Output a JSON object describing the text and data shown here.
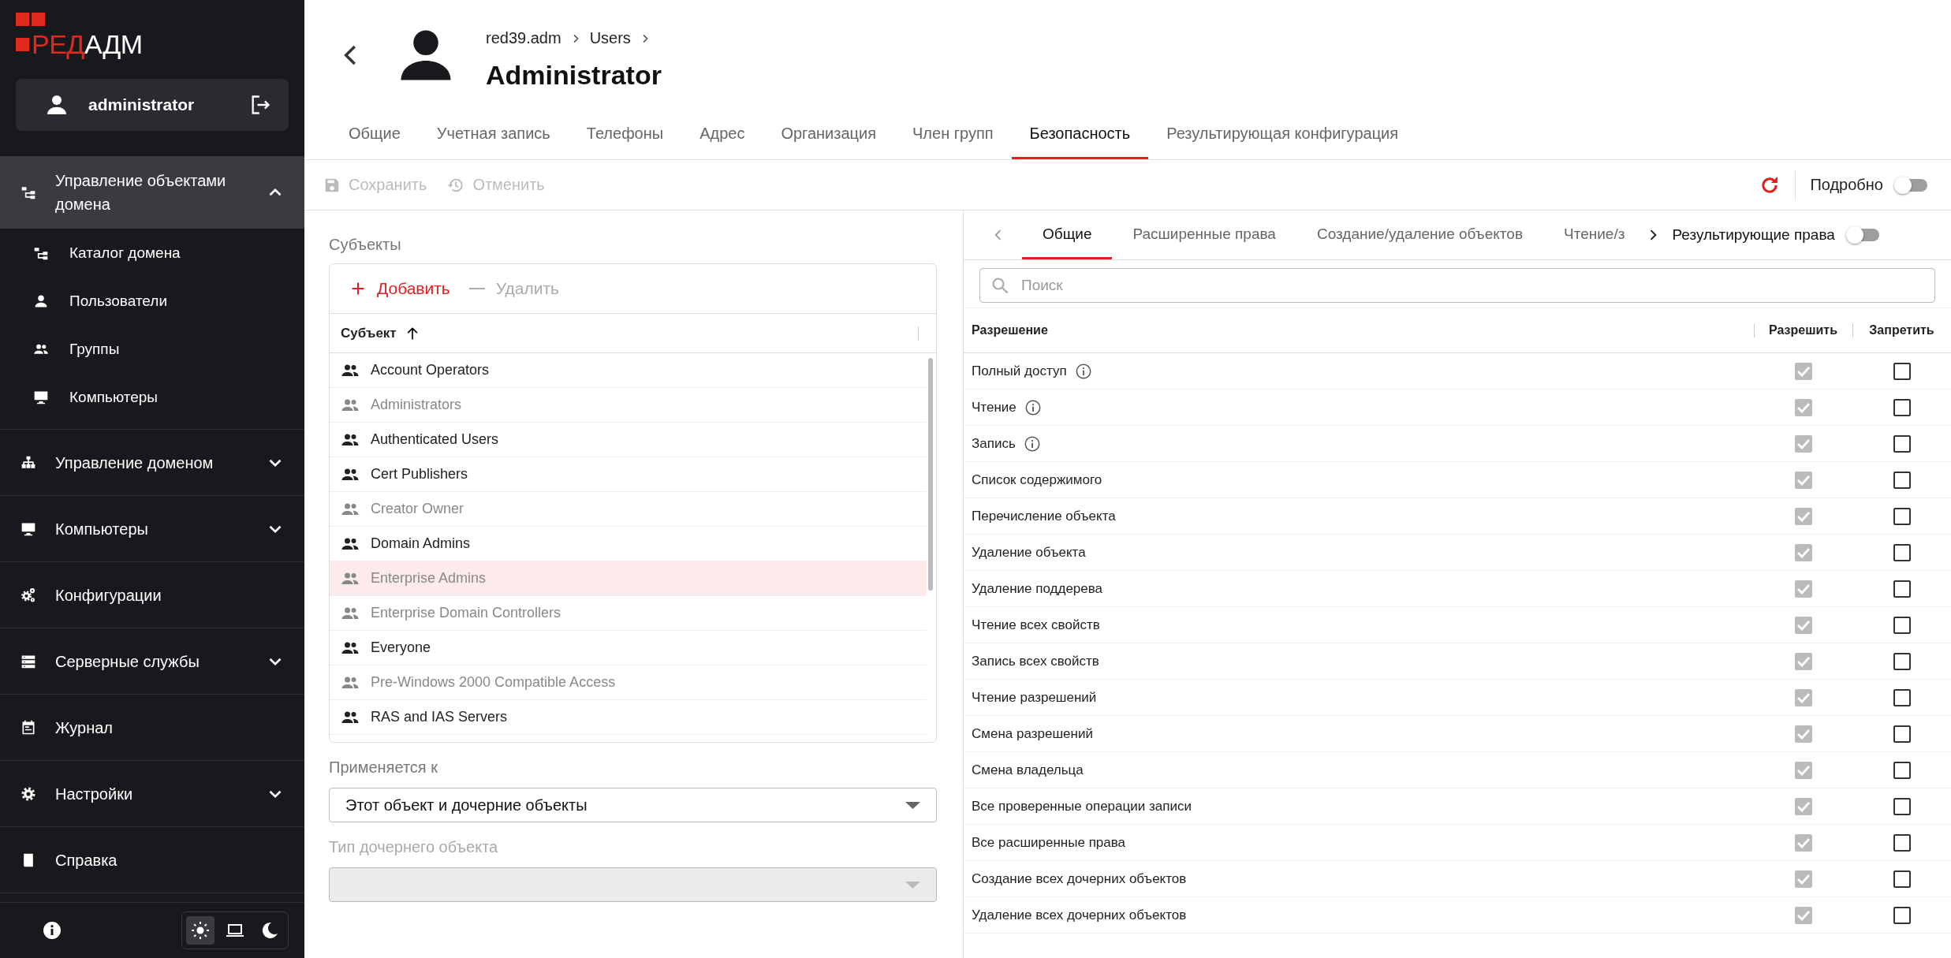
{
  "sidebar": {
    "logo": {
      "text_1": "РЕД",
      "text_2": "АДМ"
    },
    "user": {
      "name": "administrator"
    },
    "nav": [
      {
        "label": "Управление объектами домена",
        "selected": true,
        "expanded": true,
        "children": [
          {
            "label": "Каталог домена",
            "selected": false
          },
          {
            "label": "Пользователи",
            "selected": false
          },
          {
            "label": "Группы",
            "selected": false
          },
          {
            "label": "Компьютеры",
            "selected": false
          }
        ]
      },
      {
        "label": "Управление доменом",
        "selected": false,
        "expanded": false
      },
      {
        "label": "Компьютеры",
        "selected": false,
        "expanded": false
      },
      {
        "label": "Конфигурации",
        "selected": false
      },
      {
        "label": "Серверные службы",
        "selected": false,
        "expanded": false
      },
      {
        "label": "Журнал",
        "selected": false
      },
      {
        "label": "Настройки",
        "selected": false,
        "expanded": false
      },
      {
        "label": "Справка",
        "selected": false
      }
    ],
    "theme_modes": [
      {
        "selected": true
      },
      {
        "selected": false
      },
      {
        "selected": false
      }
    ]
  },
  "header": {
    "breadcrumb": [
      "red39.adm",
      "Users"
    ],
    "title": "Administrator"
  },
  "tabs": [
    {
      "label": "Общие",
      "selected": false
    },
    {
      "label": "Учетная запись",
      "selected": false
    },
    {
      "label": "Телефоны",
      "selected": false
    },
    {
      "label": "Адрес",
      "selected": false
    },
    {
      "label": "Организация",
      "selected": false
    },
    {
      "label": "Член групп",
      "selected": false
    },
    {
      "label": "Безопасность",
      "selected": true
    },
    {
      "label": "Результирующая конфигурация",
      "selected": false
    }
  ],
  "toolbar": {
    "buttons": [
      {
        "label": "Сохранить",
        "disabled": true
      },
      {
        "label": "Отменить",
        "disabled": true
      }
    ],
    "details_toggle": {
      "label": "Подробно",
      "on": false
    }
  },
  "subjects": {
    "title": "Субъекты",
    "actions": [
      {
        "label": "Добавить",
        "disabled": false
      },
      {
        "label": "Удалить",
        "disabled": true
      }
    ],
    "column": "Субъект",
    "rows": [
      {
        "name": "Account Operators",
        "inherited": false,
        "selected": false
      },
      {
        "name": "Administrators",
        "inherited": true,
        "selected": false
      },
      {
        "name": "Authenticated Users",
        "inherited": false,
        "selected": false
      },
      {
        "name": "Cert Publishers",
        "inherited": false,
        "selected": false
      },
      {
        "name": "Creator Owner",
        "inherited": true,
        "selected": false
      },
      {
        "name": "Domain Admins",
        "inherited": false,
        "selected": false
      },
      {
        "name": "Enterprise Admins",
        "inherited": true,
        "selected": true
      },
      {
        "name": "Enterprise Domain Controllers",
        "inherited": true,
        "selected": false
      },
      {
        "name": "Everyone",
        "inherited": false,
        "selected": false
      },
      {
        "name": "Pre-Windows 2000 Compatible Access",
        "inherited": true,
        "selected": false
      },
      {
        "name": "RAS and IAS Servers",
        "inherited": false,
        "selected": false
      }
    ]
  },
  "applies_to": {
    "label": "Применяется к",
    "value": "Этот объект и дочерние объекты"
  },
  "child_type": {
    "label": "Тип дочернего объекта",
    "disabled": true
  },
  "rights": {
    "tabs": [
      {
        "label": "Общие",
        "selected": true
      },
      {
        "label": "Расширенные права",
        "selected": false
      },
      {
        "label": "Создание/удаление объектов",
        "selected": false
      },
      {
        "label": "Чтение/з",
        "selected": false
      }
    ],
    "result_toggle": {
      "label": "Результирующие права",
      "on": false
    },
    "search": {
      "placeholder": "Поиск"
    },
    "columns": [
      "Разрешение",
      "Разрешить",
      "Запретить"
    ],
    "rows": [
      {
        "name": "Полный доступ",
        "info": true,
        "allow": {
          "checked": true,
          "disabled": true
        },
        "deny": {
          "checked": false,
          "disabled": false
        }
      },
      {
        "name": "Чтение",
        "info": true,
        "allow": {
          "checked": true,
          "disabled": true
        },
        "deny": {
          "checked": false,
          "disabled": false
        }
      },
      {
        "name": "Запись",
        "info": true,
        "allow": {
          "checked": true,
          "disabled": true
        },
        "deny": {
          "checked": false,
          "disabled": false
        }
      },
      {
        "name": "Список содержимого",
        "info": false,
        "allow": {
          "checked": true,
          "disabled": true
        },
        "deny": {
          "checked": false,
          "disabled": false
        }
      },
      {
        "name": "Перечисление объекта",
        "info": false,
        "allow": {
          "checked": true,
          "disabled": true
        },
        "deny": {
          "checked": false,
          "disabled": false
        }
      },
      {
        "name": "Удаление объекта",
        "info": false,
        "allow": {
          "checked": true,
          "disabled": true
        },
        "deny": {
          "checked": false,
          "disabled": false
        }
      },
      {
        "name": "Удаление поддерева",
        "info": false,
        "allow": {
          "checked": true,
          "disabled": true
        },
        "deny": {
          "checked": false,
          "disabled": false
        }
      },
      {
        "name": "Чтение всех свойств",
        "info": false,
        "allow": {
          "checked": true,
          "disabled": true
        },
        "deny": {
          "checked": false,
          "disabled": false
        }
      },
      {
        "name": "Запись всех свойств",
        "info": false,
        "allow": {
          "checked": true,
          "disabled": true
        },
        "deny": {
          "checked": false,
          "disabled": false
        }
      },
      {
        "name": "Чтение разрешений",
        "info": false,
        "allow": {
          "checked": true,
          "disabled": true
        },
        "deny": {
          "checked": false,
          "disabled": false
        }
      },
      {
        "name": "Смена разрешений",
        "info": false,
        "allow": {
          "checked": true,
          "disabled": true
        },
        "deny": {
          "checked": false,
          "disabled": false
        }
      },
      {
        "name": "Смена владельца",
        "info": false,
        "allow": {
          "checked": true,
          "disabled": true
        },
        "deny": {
          "checked": false,
          "disabled": false
        }
      },
      {
        "name": "Все проверенные операции записи",
        "info": false,
        "allow": {
          "checked": true,
          "disabled": true
        },
        "deny": {
          "checked": false,
          "disabled": false
        }
      },
      {
        "name": "Все расширенные права",
        "info": false,
        "allow": {
          "checked": true,
          "disabled": true
        },
        "deny": {
          "checked": false,
          "disabled": false
        }
      },
      {
        "name": "Создание всех дочерних объектов",
        "info": false,
        "allow": {
          "checked": true,
          "disabled": true
        },
        "deny": {
          "checked": false,
          "disabled": false
        }
      },
      {
        "name": "Удаление всех дочерних объектов",
        "info": false,
        "allow": {
          "checked": true,
          "disabled": true
        },
        "deny": {
          "checked": false,
          "disabled": false
        }
      }
    ]
  }
}
